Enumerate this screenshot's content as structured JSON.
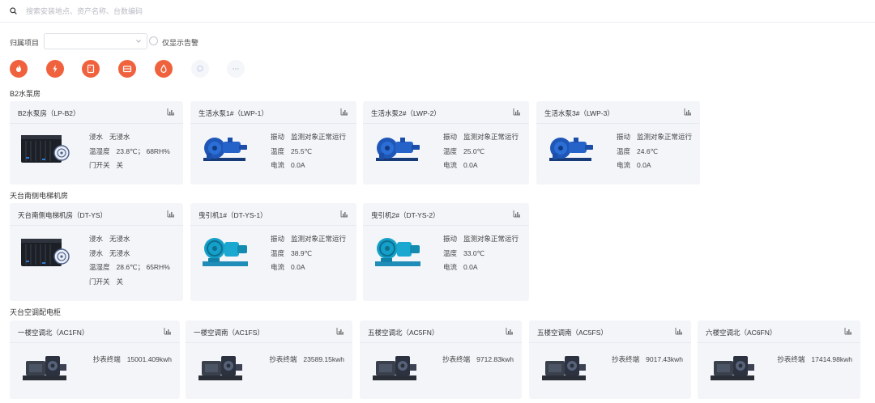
{
  "search": {
    "placeholder": "搜索安装地点、资产名称、台数编码"
  },
  "filter": {
    "project_label": "归属项目",
    "project_value": "",
    "alarm_only_label": "仅显示告警"
  },
  "categories": [
    {
      "icon": "fire-icon",
      "color": "#f0623e"
    },
    {
      "icon": "lightning-icon",
      "color": "#f0623e"
    },
    {
      "icon": "elevator-icon",
      "color": "#f0623e"
    },
    {
      "icon": "cabinet-icon",
      "color": "#f0623e"
    },
    {
      "icon": "water-drop-icon",
      "color": "#f0623e"
    },
    {
      "icon": "chat-icon",
      "color": "#dfe3ea"
    },
    {
      "icon": "more-icon",
      "color": "#dfe3ea"
    }
  ],
  "sections": [
    {
      "title": "B2水泵房"
    },
    {
      "title": "天台南侧电梯机房"
    },
    {
      "title": "天台空调配电柜"
    }
  ],
  "b2": [
    {
      "title": "B2水泵房（LP-B2）",
      "image": "power-cabinet",
      "rows": [
        {
          "k": "浸水",
          "v": "无浸水"
        },
        {
          "k": "温湿度",
          "v": "23.8℃； 68RH%"
        },
        {
          "k": "门开关",
          "v": "关"
        }
      ]
    },
    {
      "title": "生活水泵1#（LWP-1）",
      "image": "pump",
      "rows": [
        {
          "k": "振动",
          "v": "监测对象正常运行"
        },
        {
          "k": "温度",
          "v": "25.5℃"
        },
        {
          "k": "电流",
          "v": "0.0A"
        }
      ]
    },
    {
      "title": "生活水泵2#（LWP-2）",
      "image": "pump",
      "rows": [
        {
          "k": "振动",
          "v": "监测对象正常运行"
        },
        {
          "k": "温度",
          "v": "25.0℃"
        },
        {
          "k": "电流",
          "v": "0.0A"
        }
      ]
    },
    {
      "title": "生活水泵3#（LWP-3）",
      "image": "pump",
      "rows": [
        {
          "k": "振动",
          "v": "监测对象正常运行"
        },
        {
          "k": "温度",
          "v": "24.6℃"
        },
        {
          "k": "电流",
          "v": "0.0A"
        }
      ]
    }
  ],
  "elevator": [
    {
      "title": "天台南侧电梯机房（DT-YS）",
      "image": "power-cabinet",
      "rows": [
        {
          "k": "浸水",
          "v": "无浸水"
        },
        {
          "k": "浸水",
          "v": "无浸水"
        },
        {
          "k": "温湿度",
          "v": "28.6℃； 65RH%"
        },
        {
          "k": "门开关",
          "v": "关"
        }
      ]
    },
    {
      "title": "曳引机1#（DT-YS-1）",
      "image": "traction",
      "rows": [
        {
          "k": "振动",
          "v": "监测对象正常运行"
        },
        {
          "k": "温度",
          "v": "38.9℃"
        },
        {
          "k": "电流",
          "v": "0.0A"
        }
      ]
    },
    {
      "title": "曳引机2#（DT-YS-2）",
      "image": "traction",
      "rows": [
        {
          "k": "振动",
          "v": "监测对象正常运行"
        },
        {
          "k": "温度",
          "v": "33.0℃"
        },
        {
          "k": "电流",
          "v": "0.0A"
        }
      ]
    }
  ],
  "ac": [
    {
      "title": "一楼空调北（AC1FN）",
      "meter_label": "抄表终端",
      "meter_value": "15001.409kwh"
    },
    {
      "title": "一楼空调南（AC1FS）",
      "meter_label": "抄表终端",
      "meter_value": "23589.15kwh"
    },
    {
      "title": "五楼空调北（AC5FN）",
      "meter_label": "抄表终端",
      "meter_value": "9712.83kwh"
    },
    {
      "title": "五楼空调南（AC5FS）",
      "meter_label": "抄表终端",
      "meter_value": "9017.43kwh"
    },
    {
      "title": "六楼空调北（AC6FN）",
      "meter_label": "抄表终端",
      "meter_value": "17414.98kwh"
    }
  ]
}
